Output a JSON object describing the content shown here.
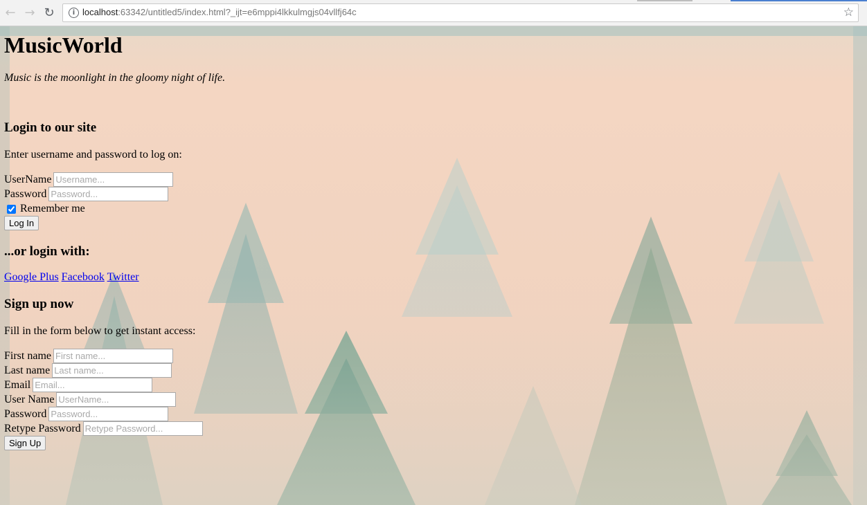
{
  "browser": {
    "url_host": "localhost",
    "url_rest": ":63342/untitled5/index.html?_ijt=e6mppi4lkkulmgjs04vllfj64c"
  },
  "site": {
    "title": "MusicWorld",
    "tagline": "Music is the moonlight in the gloomy night of life."
  },
  "login": {
    "heading": "Login to our site",
    "lead": "Enter username and password to log on:",
    "username_label": "UserName",
    "username_placeholder": "Username...",
    "password_label": "Password",
    "password_placeholder": "Password...",
    "remember_label": "Remember me",
    "remember_checked": true,
    "submit_label": "Log In"
  },
  "social": {
    "heading": "...or login with:",
    "links": [
      "Google Plus",
      "Facebook",
      "Twitter"
    ]
  },
  "signup": {
    "heading": "Sign up now",
    "lead": "Fill in the form below to get instant access:",
    "fields": [
      {
        "label": "First name",
        "placeholder": "First name..."
      },
      {
        "label": "Last name",
        "placeholder": "Last name..."
      },
      {
        "label": "Email",
        "placeholder": "Email..."
      },
      {
        "label": "User Name",
        "placeholder": "UserName..."
      },
      {
        "label": "Password",
        "placeholder": "Password..."
      },
      {
        "label": "Retype Password",
        "placeholder": "Retype Password..."
      }
    ],
    "submit_label": "Sign Up"
  }
}
